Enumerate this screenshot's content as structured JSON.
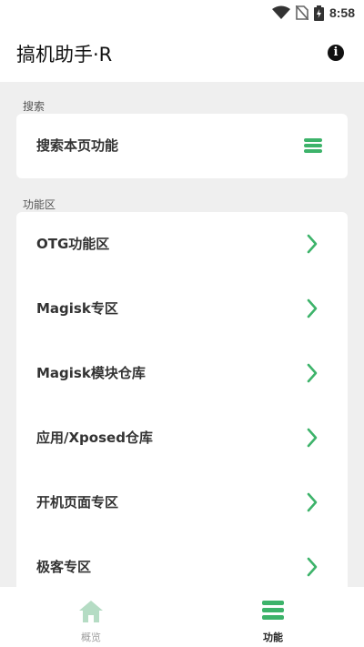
{
  "status": {
    "time": "8:58"
  },
  "app": {
    "title": "搞机助手·R",
    "info_icon": "info-icon"
  },
  "search_section": {
    "label": "搜索",
    "item_label": "搜索本页功能",
    "icon": "menu-icon"
  },
  "feature_section": {
    "label": "功能区",
    "items": [
      {
        "label": "OTG功能区"
      },
      {
        "label": "Magisk专区"
      },
      {
        "label": "Magisk模块仓库"
      },
      {
        "label": "应用/Xposed仓库"
      },
      {
        "label": "开机页面专区"
      },
      {
        "label": "极客专区"
      }
    ]
  },
  "bottom_nav": {
    "items": [
      {
        "label": "概览",
        "icon": "home-icon",
        "active": false
      },
      {
        "label": "功能",
        "icon": "menu-icon",
        "active": true
      }
    ]
  },
  "colors": {
    "accent": "#3db36a",
    "background": "#efefef",
    "inactive": "#9e9e9e"
  }
}
